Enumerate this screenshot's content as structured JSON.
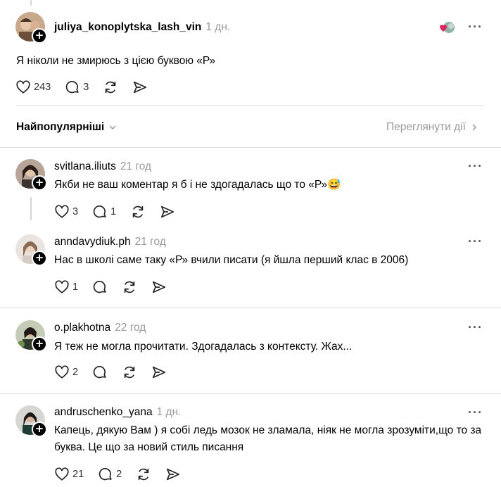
{
  "post": {
    "username": "juliya_konoplytska_lash_vin",
    "time": "1 дн.",
    "text": "Я ніколи не змирюсь з цією буквою «Р»",
    "likes": "243",
    "replies": "3"
  },
  "sort": {
    "label": "Найпопулярніші",
    "view_activity": "Переглянути дії"
  },
  "comments": [
    {
      "username": "svitlana.iliuts",
      "time": "21 год",
      "text": "Якби не ваш коментар я б і не здогадалась що то «Р»😅",
      "likes": "3",
      "replies": "1"
    },
    {
      "username": "anndavydiuk.ph",
      "time": "21 год",
      "text": "Нас в школі саме таку «Р» вчили писати (я йшла перший клас в 2006)",
      "likes": "1",
      "replies": ""
    },
    {
      "username": "o.plakhotna",
      "time": "22 год",
      "text": "Я теж не могла прочитати. Здогадалась з контексту. Жах...",
      "likes": "2",
      "replies": ""
    },
    {
      "username": "andruschenko_yana",
      "time": "1 дн.",
      "text": "Капець, дякую Вам ) я собі ледь мозок не зламала, ніяк не могла зрозуміти,що то за буква. Це що за новий стиль писання",
      "likes": "21",
      "replies": "2"
    }
  ],
  "colors": {
    "muted": "#999999",
    "divider": "#dcdcdc",
    "heart": "#e0245e"
  }
}
